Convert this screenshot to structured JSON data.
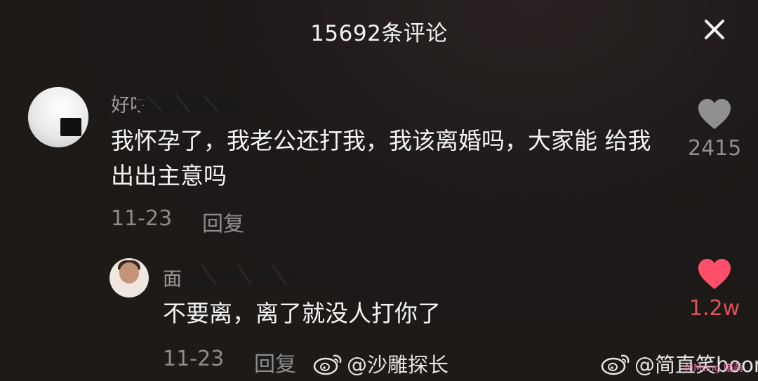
{
  "header": {
    "title": "15692条评论",
    "close_icon": "close-icon"
  },
  "comments": [
    {
      "username": "好吃",
      "text": "我怀孕了，我老公还打我，我该离婚吗，大家能 给我出出主意吗",
      "date": "11-23",
      "reply_label": "回复",
      "like_count": "2415",
      "liked": false,
      "like_color": "#8f8f8f"
    },
    {
      "username": "面",
      "text": "不要离，离了就没人打你了",
      "date": "11-23",
      "reply_label": "回复",
      "like_count": "1.2w",
      "liked": true,
      "like_color": "#ff4f6b"
    }
  ],
  "watermarks": [
    {
      "icon": "weibo-icon",
      "text": "@沙雕探长"
    },
    {
      "icon": "weibo-icon",
      "text": "@简直笑boom了"
    }
  ],
  "watermark_small": "MMeng 喵萌"
}
